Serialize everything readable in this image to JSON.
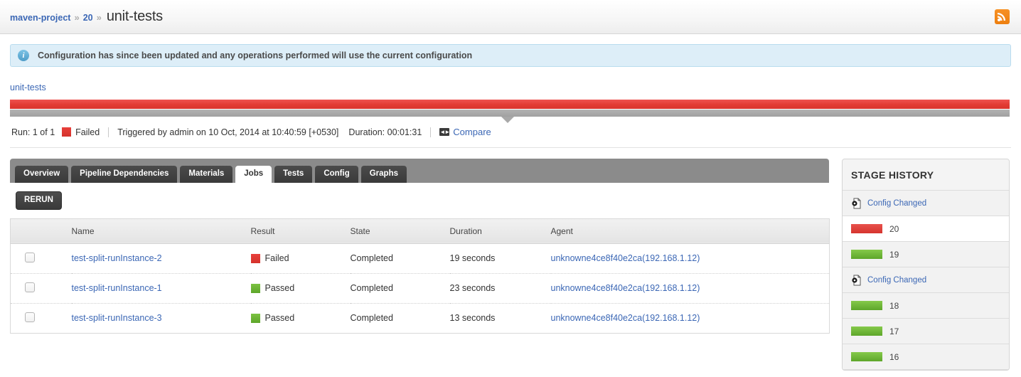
{
  "header": {
    "breadcrumb": [
      {
        "label": "maven-project",
        "type": "link"
      },
      {
        "label": "20",
        "type": "link"
      },
      {
        "label": "unit-tests",
        "type": "current"
      }
    ],
    "separator": "»",
    "rss_icon": "rss-feed-icon"
  },
  "notice": {
    "icon": "info-icon",
    "text": "Configuration has since been updated and any operations performed will use the current configuration"
  },
  "stage": {
    "name": "unit-tests",
    "bar_status_color": "#e23b33",
    "bar_secondary_color": "#a0a0a0"
  },
  "run_summary": {
    "run_label": "Run: 1 of 1",
    "result": "Failed",
    "result_color": "#d4322c",
    "triggered_by": "Triggered by admin on 10 Oct, 2014 at 10:40:59 [+0530]",
    "duration": "Duration: 00:01:31",
    "compare_label": "Compare",
    "compare_icon": "compare-icon"
  },
  "tabs": [
    {
      "label": "Overview",
      "active": false
    },
    {
      "label": "Pipeline Dependencies",
      "active": false
    },
    {
      "label": "Materials",
      "active": false
    },
    {
      "label": "Jobs",
      "active": true
    },
    {
      "label": "Tests",
      "active": false
    },
    {
      "label": "Config",
      "active": false
    },
    {
      "label": "Graphs",
      "active": false
    }
  ],
  "actions": {
    "rerun_label": "RERUN"
  },
  "jobs_table": {
    "columns": [
      "",
      "Name",
      "Result",
      "State",
      "Duration",
      "Agent"
    ],
    "rows": [
      {
        "checked": false,
        "name": "test-split-runInstance-2",
        "result": "Failed",
        "result_color": "#d4322c",
        "state": "Completed",
        "duration": "19 seconds",
        "agent": "unknowne4ce8f40e2ca(192.168.1.12)"
      },
      {
        "checked": false,
        "name": "test-split-runInstance-1",
        "result": "Passed",
        "result_color": "#5da62a",
        "state": "Completed",
        "duration": "23 seconds",
        "agent": "unknowne4ce8f40e2ca(192.168.1.12)"
      },
      {
        "checked": false,
        "name": "test-split-runInstance-3",
        "result": "Passed",
        "result_color": "#5da62a",
        "state": "Completed",
        "duration": "13 seconds",
        "agent": "unknowne4ce8f40e2ca(192.168.1.12)"
      }
    ]
  },
  "stage_history": {
    "title": "STAGE HISTORY",
    "entries": [
      {
        "kind": "config",
        "label": "Config Changed",
        "icon": "config-changed-icon"
      },
      {
        "kind": "stage",
        "label": "20",
        "status": "failed",
        "current": true
      },
      {
        "kind": "stage",
        "label": "19",
        "status": "passed",
        "current": false
      },
      {
        "kind": "config",
        "label": "Config Changed",
        "icon": "config-changed-icon"
      },
      {
        "kind": "stage",
        "label": "18",
        "status": "passed",
        "current": false
      },
      {
        "kind": "stage",
        "label": "17",
        "status": "passed",
        "current": false
      },
      {
        "kind": "stage",
        "label": "16",
        "status": "passed",
        "current": false
      }
    ]
  }
}
